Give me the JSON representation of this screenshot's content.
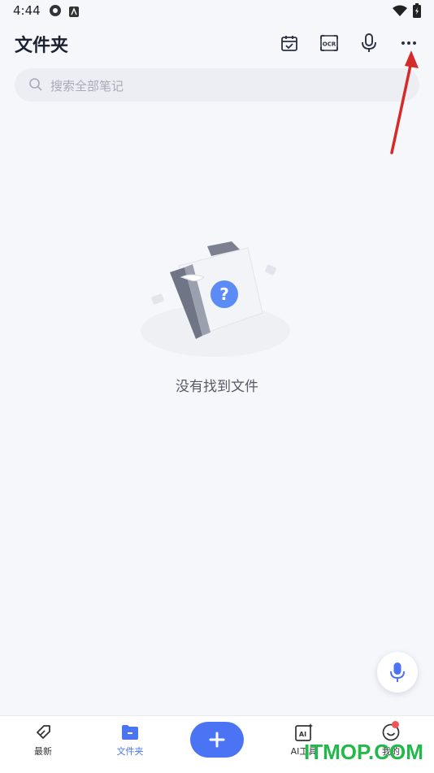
{
  "status_bar": {
    "time": "4:44"
  },
  "header": {
    "title": "文件夹"
  },
  "search": {
    "placeholder": "搜索全部笔记"
  },
  "empty_state": {
    "message": "没有找到文件"
  },
  "tabbar": {
    "items": [
      {
        "label": "最新",
        "icon": "tag-icon"
      },
      {
        "label": "文件夹",
        "icon": "folder-icon",
        "active": true
      },
      {
        "label": "+",
        "icon": "plus-icon"
      },
      {
        "label": "AI工具",
        "icon": "ai-icon"
      },
      {
        "label": "我的",
        "icon": "smile-icon"
      }
    ]
  },
  "watermark": "ITMOP.COM",
  "colors": {
    "accent": "#4b74f5",
    "background": "#f6f7fb",
    "arrow": "#d42a2a",
    "watermark": "#22b84a"
  }
}
